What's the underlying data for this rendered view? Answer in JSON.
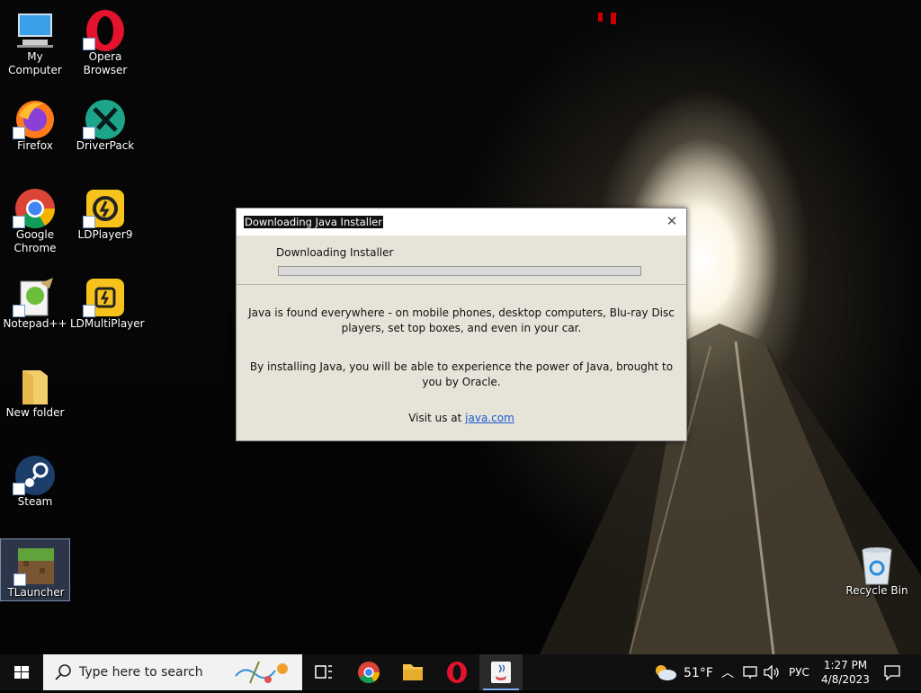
{
  "desktop": {
    "icons": [
      {
        "label": "My Computer",
        "icon": "computer-icon"
      },
      {
        "label": "Opera Browser",
        "icon": "opera-icon"
      },
      {
        "label": "Firefox",
        "icon": "firefox-icon"
      },
      {
        "label": "DriverPack",
        "icon": "driverpack-icon"
      },
      {
        "label": "Google Chrome",
        "icon": "chrome-icon"
      },
      {
        "label": "LDPlayer9",
        "icon": "ldplayer-icon"
      },
      {
        "label": "Notepad++",
        "icon": "notepadpp-icon"
      },
      {
        "label": "LDMultiPlayer",
        "icon": "ldmultiplayer-icon"
      },
      {
        "label": "New folder",
        "icon": "folder-icon"
      },
      {
        "label": "Steam",
        "icon": "steam-icon"
      },
      {
        "label": "TLauncher",
        "icon": "tlauncher-icon"
      },
      {
        "label": "Recycle Bin",
        "icon": "recycle-bin-icon"
      }
    ]
  },
  "dialog": {
    "title": "Downloading Java Installer",
    "status": "Downloading Installer",
    "progress_percent": 0,
    "paragraph1": "Java is found everywhere - on mobile phones, desktop computers, Blu-ray Disc players, set top boxes, and even in your car.",
    "paragraph2": "By installing Java, you will be able to experience the power of Java, brought to you by Oracle.",
    "visit_prefix": "Visit us at ",
    "visit_link": "java.com"
  },
  "taskbar": {
    "search_placeholder": "Type here to search",
    "weather_temp": "51°F",
    "language": "РУС",
    "time": "1:27 PM",
    "date": "4/8/2023"
  },
  "colors": {
    "taskbar_bg": "#101010",
    "dialog_bg": "#e6e3d8",
    "link": "#1a5ccf"
  }
}
